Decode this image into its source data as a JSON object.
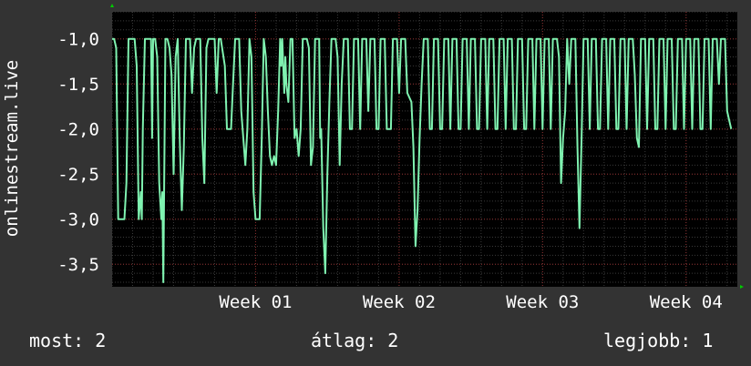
{
  "colors": {
    "background": "#333333",
    "plot_background": "#000000",
    "grid_minor": "#3a3a3a",
    "grid_major": "#8a2a2a",
    "line": "#7ff2b0",
    "text": "#ffffff",
    "axis_arrow": "#00cc00"
  },
  "footer": {
    "now": "most: 2",
    "avg": "átlag: 2",
    "best": "legjobb: 1"
  },
  "chart_data": {
    "type": "line",
    "ylabel": "onlinestream.live",
    "ylim": [
      -3.75,
      -0.7
    ],
    "xlim": [
      0,
      30.5
    ],
    "y_ticks": [
      {
        "value": -1.0,
        "label": "-1,0"
      },
      {
        "value": -1.5,
        "label": "-1,5"
      },
      {
        "value": -2.0,
        "label": "-2,0"
      },
      {
        "value": -2.5,
        "label": "-2,5"
      },
      {
        "value": -3.0,
        "label": "-3,0"
      },
      {
        "value": -3.5,
        "label": "-3,5"
      }
    ],
    "x_ticks": [
      {
        "value": 7,
        "label": "Week 01"
      },
      {
        "value": 14,
        "label": "Week 02"
      },
      {
        "value": 21,
        "label": "Week 03"
      },
      {
        "value": 28,
        "label": "Week 04"
      }
    ],
    "grid": true,
    "series": [
      {
        "values": [
          [
            0.0,
            -1.0
          ],
          [
            0.1,
            -1.0
          ],
          [
            0.2,
            -1.1
          ],
          [
            0.3,
            -3.0
          ],
          [
            0.5,
            -3.0
          ],
          [
            0.6,
            -3.0
          ],
          [
            0.7,
            -2.6
          ],
          [
            0.8,
            -1.0
          ],
          [
            1.1,
            -1.0
          ],
          [
            1.2,
            -1.3
          ],
          [
            1.3,
            -3.0
          ],
          [
            1.4,
            -2.7
          ],
          [
            1.45,
            -3.0
          ],
          [
            1.5,
            -2.0
          ],
          [
            1.6,
            -1.0
          ],
          [
            1.8,
            -1.0
          ],
          [
            1.9,
            -1.0
          ],
          [
            1.95,
            -2.1
          ],
          [
            2.0,
            -1.0
          ],
          [
            2.1,
            -1.0
          ],
          [
            2.2,
            -1.2
          ],
          [
            2.3,
            -2.6
          ],
          [
            2.4,
            -3.0
          ],
          [
            2.45,
            -2.7
          ],
          [
            2.5,
            -3.7
          ],
          [
            2.6,
            -1.0
          ],
          [
            2.7,
            -1.0
          ],
          [
            2.8,
            -1.1
          ],
          [
            2.9,
            -1.4
          ],
          [
            3.0,
            -2.5
          ],
          [
            3.1,
            -1.2
          ],
          [
            3.2,
            -1.0
          ],
          [
            3.3,
            -2.1
          ],
          [
            3.4,
            -2.9
          ],
          [
            3.5,
            -2.2
          ],
          [
            3.6,
            -1.0
          ],
          [
            3.8,
            -1.0
          ],
          [
            3.9,
            -1.6
          ],
          [
            4.0,
            -1.1
          ],
          [
            4.1,
            -1.0
          ],
          [
            4.3,
            -1.0
          ],
          [
            4.4,
            -2.1
          ],
          [
            4.5,
            -2.6
          ],
          [
            4.6,
            -1.1
          ],
          [
            4.7,
            -1.0
          ],
          [
            5.0,
            -1.0
          ],
          [
            5.1,
            -1.6
          ],
          [
            5.2,
            -1.0
          ],
          [
            5.3,
            -1.0
          ],
          [
            5.5,
            -1.3
          ],
          [
            5.6,
            -2.0
          ],
          [
            5.7,
            -2.0
          ],
          [
            5.8,
            -2.0
          ],
          [
            5.9,
            -1.5
          ],
          [
            6.0,
            -1.0
          ],
          [
            6.2,
            -1.0
          ],
          [
            6.3,
            -1.8
          ],
          [
            6.5,
            -2.4
          ],
          [
            6.6,
            -2.0
          ],
          [
            6.7,
            -1.0
          ],
          [
            6.8,
            -1.2
          ],
          [
            6.9,
            -2.7
          ],
          [
            7.0,
            -3.0
          ],
          [
            7.2,
            -3.0
          ],
          [
            7.3,
            -2.1
          ],
          [
            7.4,
            -1.0
          ],
          [
            7.5,
            -1.2
          ],
          [
            7.6,
            -1.8
          ],
          [
            7.7,
            -2.3
          ],
          [
            7.8,
            -2.4
          ],
          [
            7.9,
            -2.3
          ],
          [
            8.0,
            -2.4
          ],
          [
            8.1,
            -1.8
          ],
          [
            8.2,
            -1.0
          ],
          [
            8.25,
            -1.3
          ],
          [
            8.3,
            -1.0
          ],
          [
            8.4,
            -1.6
          ],
          [
            8.45,
            -1.2
          ],
          [
            8.5,
            -1.5
          ],
          [
            8.6,
            -1.7
          ],
          [
            8.7,
            -1.0
          ],
          [
            8.8,
            -1.0
          ],
          [
            8.9,
            -2.1
          ],
          [
            9.0,
            -2.0
          ],
          [
            9.1,
            -2.3
          ],
          [
            9.2,
            -2.0
          ],
          [
            9.3,
            -1.0
          ],
          [
            9.5,
            -1.0
          ],
          [
            9.6,
            -1.1
          ],
          [
            9.7,
            -2.4
          ],
          [
            9.8,
            -2.2
          ],
          [
            9.9,
            -1.0
          ],
          [
            10.1,
            -1.0
          ],
          [
            10.15,
            -2.1
          ],
          [
            10.2,
            -2.0
          ],
          [
            10.3,
            -3.1
          ],
          [
            10.4,
            -3.6
          ],
          [
            10.5,
            -2.5
          ],
          [
            10.6,
            -1.7
          ],
          [
            10.7,
            -1.0
          ],
          [
            10.9,
            -1.0
          ],
          [
            11.0,
            -1.2
          ],
          [
            11.1,
            -2.4
          ],
          [
            11.2,
            -1.5
          ],
          [
            11.3,
            -1.0
          ],
          [
            11.5,
            -1.0
          ],
          [
            11.6,
            -2.0
          ],
          [
            11.7,
            -2.0
          ],
          [
            11.8,
            -1.0
          ],
          [
            12.0,
            -1.0
          ],
          [
            12.1,
            -2.0
          ],
          [
            12.2,
            -1.0
          ],
          [
            12.4,
            -1.0
          ],
          [
            12.5,
            -1.8
          ],
          [
            12.6,
            -1.0
          ],
          [
            12.8,
            -1.0
          ],
          [
            12.9,
            -2.0
          ],
          [
            13.0,
            -2.0
          ],
          [
            13.1,
            -1.0
          ],
          [
            13.3,
            -1.0
          ],
          [
            13.4,
            -2.0
          ],
          [
            13.6,
            -2.0
          ],
          [
            13.7,
            -1.0
          ],
          [
            13.9,
            -1.0
          ],
          [
            14.0,
            -1.6
          ],
          [
            14.1,
            -1.0
          ],
          [
            14.3,
            -1.0
          ],
          [
            14.4,
            -1.6
          ],
          [
            14.6,
            -1.7
          ],
          [
            14.7,
            -2.2
          ],
          [
            14.8,
            -3.3
          ],
          [
            14.9,
            -2.9
          ],
          [
            15.0,
            -2.1
          ],
          [
            15.1,
            -1.5
          ],
          [
            15.2,
            -1.0
          ],
          [
            15.4,
            -1.0
          ],
          [
            15.5,
            -2.0
          ],
          [
            15.6,
            -2.0
          ],
          [
            15.7,
            -1.0
          ],
          [
            15.9,
            -1.0
          ],
          [
            16.0,
            -2.0
          ],
          [
            16.1,
            -2.0
          ],
          [
            16.2,
            -1.0
          ],
          [
            16.4,
            -1.0
          ],
          [
            16.5,
            -2.0
          ],
          [
            16.6,
            -1.0
          ],
          [
            16.8,
            -1.0
          ],
          [
            16.9,
            -2.0
          ],
          [
            17.0,
            -2.0
          ],
          [
            17.1,
            -1.0
          ],
          [
            17.3,
            -1.0
          ],
          [
            17.4,
            -2.0
          ],
          [
            17.5,
            -1.0
          ],
          [
            17.7,
            -1.0
          ],
          [
            17.8,
            -2.0
          ],
          [
            17.9,
            -2.0
          ],
          [
            18.0,
            -1.0
          ],
          [
            18.2,
            -1.0
          ],
          [
            18.3,
            -2.0
          ],
          [
            18.4,
            -1.0
          ],
          [
            18.6,
            -1.0
          ],
          [
            18.7,
            -2.0
          ],
          [
            18.8,
            -2.0
          ],
          [
            18.9,
            -1.0
          ],
          [
            19.1,
            -1.0
          ],
          [
            19.2,
            -2.0
          ],
          [
            19.3,
            -1.0
          ],
          [
            19.5,
            -1.0
          ],
          [
            19.6,
            -2.0
          ],
          [
            19.7,
            -2.0
          ],
          [
            19.8,
            -1.0
          ],
          [
            20.0,
            -1.0
          ],
          [
            20.1,
            -2.0
          ],
          [
            20.2,
            -2.0
          ],
          [
            20.3,
            -1.0
          ],
          [
            20.5,
            -1.0
          ],
          [
            20.6,
            -2.0
          ],
          [
            20.7,
            -1.0
          ],
          [
            20.9,
            -1.0
          ],
          [
            21.0,
            -2.0
          ],
          [
            21.1,
            -1.0
          ],
          [
            21.3,
            -1.0
          ],
          [
            21.4,
            -2.0
          ],
          [
            21.5,
            -1.0
          ],
          [
            21.7,
            -1.0
          ],
          [
            21.8,
            -1.2
          ],
          [
            21.9,
            -2.6
          ],
          [
            22.0,
            -2.1
          ],
          [
            22.1,
            -1.8
          ],
          [
            22.2,
            -1.0
          ],
          [
            22.3,
            -1.5
          ],
          [
            22.4,
            -1.0
          ],
          [
            22.6,
            -1.0
          ],
          [
            22.7,
            -2.2
          ],
          [
            22.8,
            -3.1
          ],
          [
            22.9,
            -2.1
          ],
          [
            23.0,
            -1.0
          ],
          [
            23.2,
            -1.0
          ],
          [
            23.3,
            -2.0
          ],
          [
            23.4,
            -1.0
          ],
          [
            23.6,
            -1.0
          ],
          [
            23.7,
            -2.0
          ],
          [
            23.8,
            -2.0
          ],
          [
            23.9,
            -1.0
          ],
          [
            24.1,
            -1.0
          ],
          [
            24.2,
            -2.0
          ],
          [
            24.3,
            -1.0
          ],
          [
            24.5,
            -1.0
          ],
          [
            24.6,
            -2.0
          ],
          [
            24.7,
            -2.0
          ],
          [
            24.8,
            -1.0
          ],
          [
            25.0,
            -1.0
          ],
          [
            25.1,
            -2.0
          ],
          [
            25.2,
            -1.0
          ],
          [
            25.4,
            -1.0
          ],
          [
            25.5,
            -1.4
          ],
          [
            25.6,
            -2.1
          ],
          [
            25.7,
            -2.2
          ],
          [
            25.8,
            -1.0
          ],
          [
            26.0,
            -1.0
          ],
          [
            26.1,
            -2.0
          ],
          [
            26.2,
            -1.0
          ],
          [
            26.4,
            -1.0
          ],
          [
            26.5,
            -2.0
          ],
          [
            26.6,
            -2.0
          ],
          [
            26.7,
            -1.0
          ],
          [
            26.9,
            -1.0
          ],
          [
            27.0,
            -2.0
          ],
          [
            27.1,
            -1.0
          ],
          [
            27.3,
            -1.0
          ],
          [
            27.4,
            -2.0
          ],
          [
            27.5,
            -2.0
          ],
          [
            27.6,
            -1.0
          ],
          [
            27.8,
            -1.0
          ],
          [
            27.9,
            -2.0
          ],
          [
            28.0,
            -1.0
          ],
          [
            28.2,
            -1.0
          ],
          [
            28.3,
            -2.0
          ],
          [
            28.4,
            -1.0
          ],
          [
            28.6,
            -1.0
          ],
          [
            28.7,
            -2.0
          ],
          [
            28.8,
            -2.0
          ],
          [
            28.9,
            -1.0
          ],
          [
            29.1,
            -1.0
          ],
          [
            29.2,
            -2.0
          ],
          [
            29.3,
            -1.0
          ],
          [
            29.5,
            -1.0
          ],
          [
            29.6,
            -1.5
          ],
          [
            29.7,
            -1.0
          ],
          [
            29.9,
            -1.0
          ],
          [
            30.0,
            -1.8
          ],
          [
            30.1,
            -1.9
          ],
          [
            30.2,
            -2.0
          ]
        ]
      }
    ]
  }
}
